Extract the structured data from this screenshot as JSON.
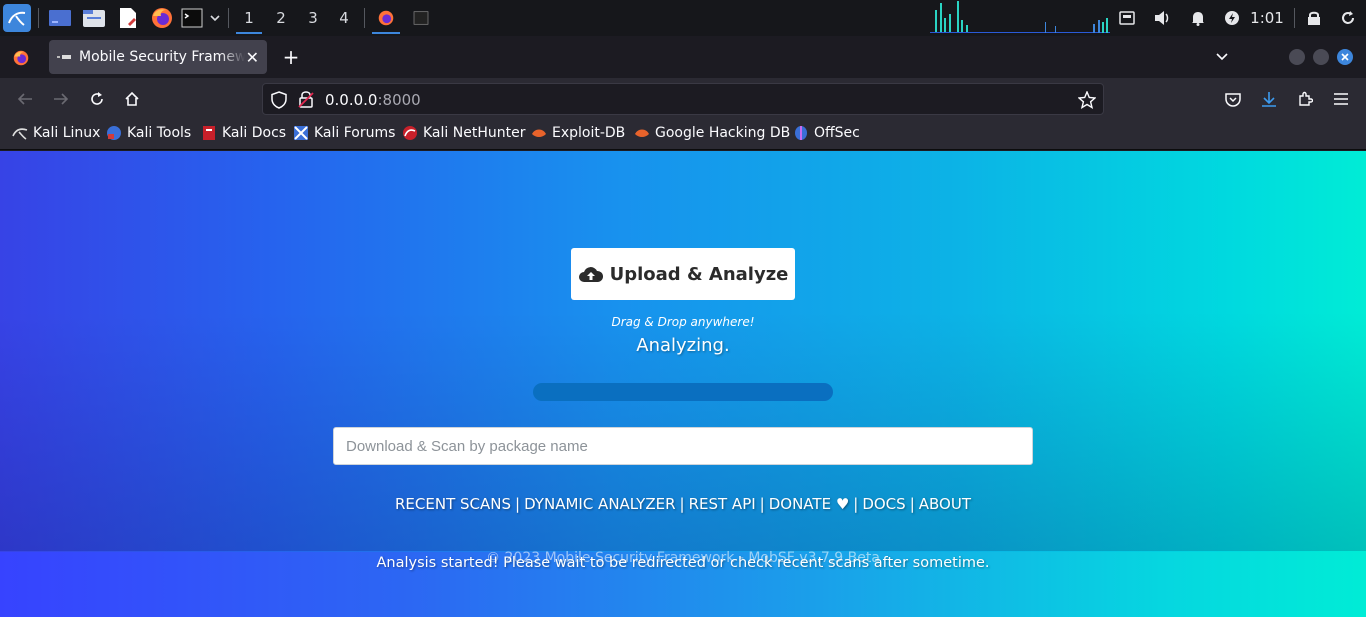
{
  "panel": {
    "workspaces": [
      "1",
      "2",
      "3",
      "4"
    ],
    "active_workspace": "1",
    "clock": "1:01",
    "icons": [
      "kali-menu-icon",
      "desktop-icon",
      "file-manager-icon",
      "text-editor-icon",
      "firefox-icon",
      "terminal-icon",
      "chevron-down-icon",
      "network-icon",
      "volume-icon",
      "notification-icon",
      "power-icon",
      "lock-icon",
      "refresh-icon"
    ]
  },
  "browser": {
    "tab_title": "Mobile Security Framework",
    "url_host": "0.0.0.0",
    "url_port": ":8000",
    "bookmarks": [
      "Kali Linux",
      "Kali Tools",
      "Kali Docs",
      "Kali Forums",
      "Kali NetHunter",
      "Exploit-DB",
      "Google Hacking DB",
      "OffSec"
    ]
  },
  "page": {
    "upload_label": "Upload & Analyze",
    "drag_hint": "Drag & Drop anywhere!",
    "status": "Analyzing.",
    "progress": 1.0,
    "search_placeholder": "Download & Scan by package name",
    "links": [
      "RECENT SCANS",
      "DYNAMIC ANALYZER",
      "REST API",
      "DONATE ♥",
      "DOCS",
      "ABOUT"
    ],
    "copyright": "© 2023 Mobile Security Framework - MobSF v3.7.9 Beta",
    "analysis_message": "Analysis started! Please wait to be redirected or check recent scans after sometime."
  },
  "colors": {
    "accent": "#3d86dc",
    "page_gradient_start": "#3743e6",
    "page_gradient_end": "#00ecd6",
    "progress_bar": "#0a63b3"
  }
}
